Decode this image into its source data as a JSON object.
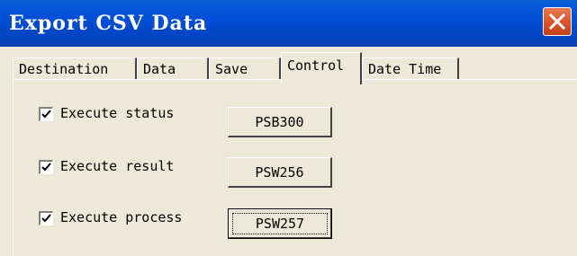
{
  "window": {
    "title": "Export CSV Data"
  },
  "tabs": [
    {
      "label": "Destination",
      "active": false
    },
    {
      "label": "Data",
      "active": false
    },
    {
      "label": "Save",
      "active": false
    },
    {
      "label": "Control",
      "active": true
    },
    {
      "label": "Date Time",
      "active": false
    }
  ],
  "control": {
    "rows": [
      {
        "label": "Execute status",
        "checked": true,
        "button": "PSB300",
        "focused": false
      },
      {
        "label": "Execute result",
        "checked": true,
        "button": "PSW256",
        "focused": false
      },
      {
        "label": "Execute process",
        "checked": true,
        "button": "PSW257",
        "focused": true
      }
    ]
  },
  "icons": {
    "close": "close-icon",
    "check": "checkmark-icon"
  },
  "colors": {
    "titlebar": "#0050d8",
    "close_button": "#d6522b",
    "window_bg": "#ece9d8"
  }
}
